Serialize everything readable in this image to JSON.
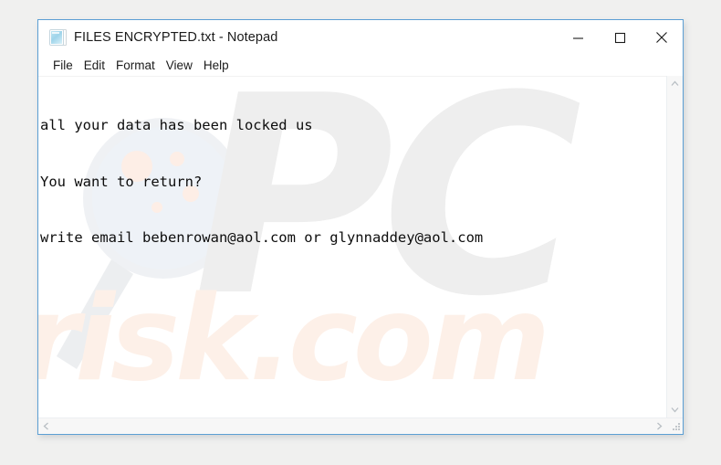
{
  "desktop": {
    "background_color": "#f0f0ef"
  },
  "window": {
    "title": "FILES ENCRYPTED.txt - Notepad",
    "icon": "notepad-document-icon",
    "border_color": "#5c9fd4",
    "background_color": "#ffffff",
    "controls": [
      {
        "name": "minimize",
        "glyph": "—",
        "label": "Minimize"
      },
      {
        "name": "maximize",
        "glyph": "□",
        "label": "Maximize"
      },
      {
        "name": "close",
        "glyph": "✕",
        "label": "Close"
      }
    ]
  },
  "menu": {
    "items": [
      {
        "label": "File"
      },
      {
        "label": "Edit"
      },
      {
        "label": "Format"
      },
      {
        "label": "View"
      },
      {
        "label": "Help"
      }
    ]
  },
  "document": {
    "lines": [
      "all your data has been locked us",
      "You want to return?",
      "write email bebenrowan@aol.com or glynnaddey@aol.com"
    ],
    "emails": [
      "bebenrowan@aol.com",
      "glynnaddey@aol.com"
    ],
    "text_color": "#0d0d0d"
  },
  "watermark": {
    "pc_text": "PC",
    "pc_color": "#eeeeee",
    "risk_text": "risk.com",
    "risk_color": "#fdf0e8",
    "glass_icon": "magnifying-glass-icon"
  },
  "scrollbars": {
    "vertical": {
      "up_arrow": "chevron-up-icon",
      "down_arrow": "chevron-down-icon"
    },
    "horizontal": {
      "left_arrow": "chevron-left-icon",
      "right_arrow": "chevron-right-icon"
    },
    "resize_grip": "resize-grip-icon"
  }
}
